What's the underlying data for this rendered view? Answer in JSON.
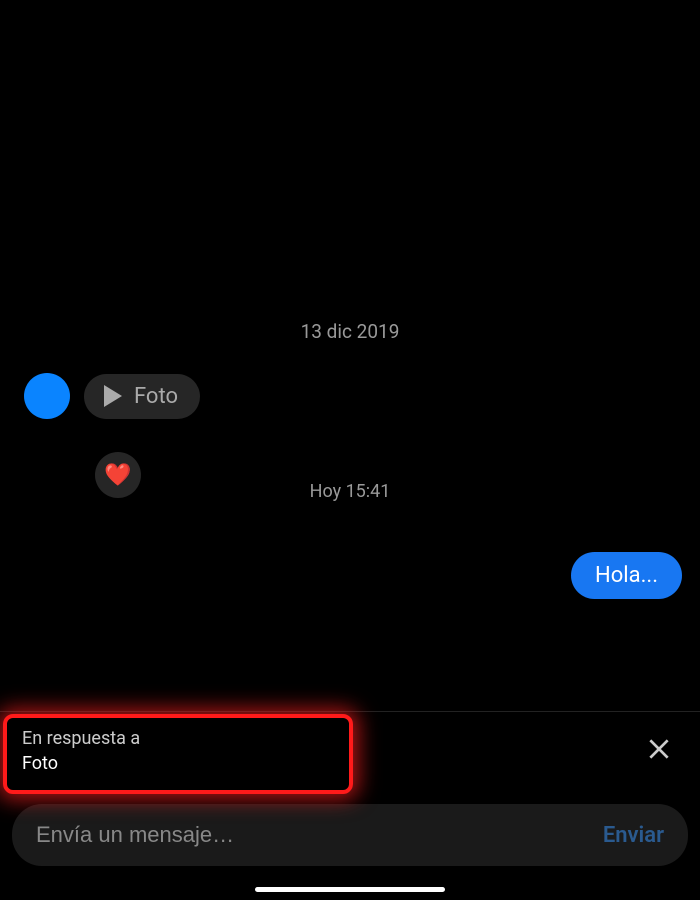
{
  "chat": {
    "date_separator_1": "13 dic 2019",
    "incoming": {
      "media_label": "Foto",
      "reaction": "❤️"
    },
    "time_separator": "Hoy 15:41",
    "outgoing": {
      "text": "Hola..."
    }
  },
  "reply_context": {
    "title": "En respuesta a",
    "content": "Foto"
  },
  "composer": {
    "placeholder": "Envía un mensaje…",
    "send_label": "Enviar"
  }
}
